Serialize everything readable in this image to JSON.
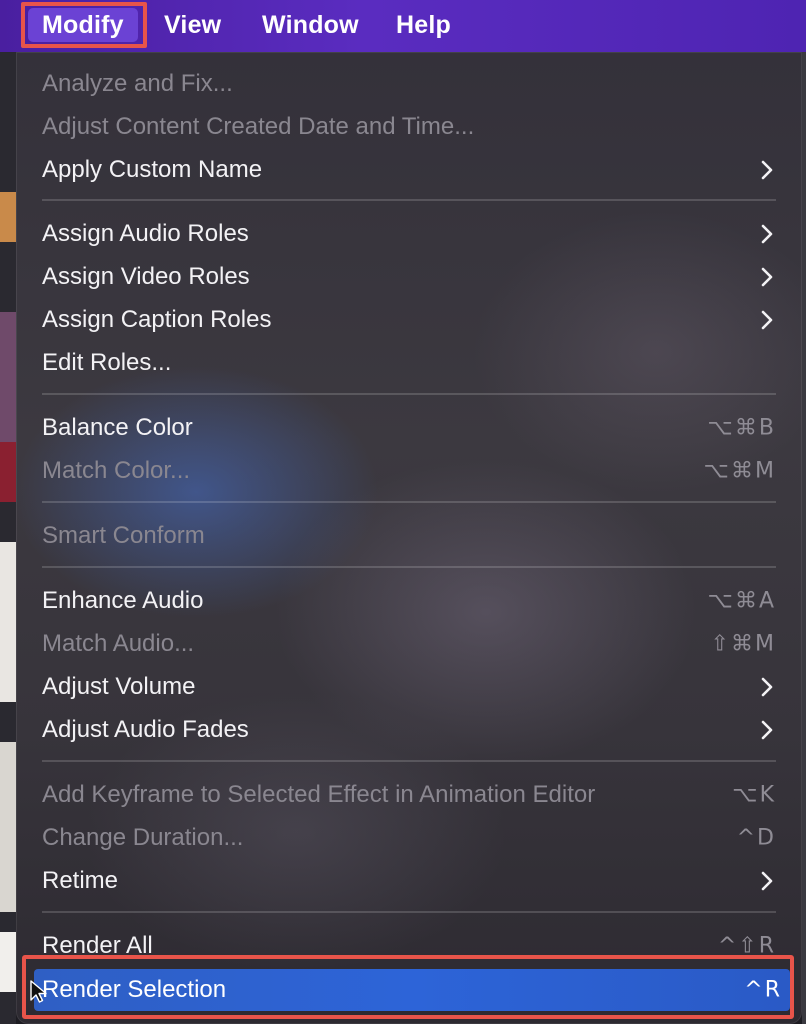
{
  "menubar": {
    "items": [
      {
        "label": "Modify",
        "active": true
      },
      {
        "label": "View",
        "active": false
      },
      {
        "label": "Window",
        "active": false
      },
      {
        "label": "Help",
        "active": false
      }
    ]
  },
  "menu": {
    "items": [
      {
        "label": "Analyze and Fix...",
        "enabled": false,
        "shortcut": "",
        "submenu": false
      },
      {
        "label": "Adjust Content Created Date and Time...",
        "enabled": false,
        "shortcut": "",
        "submenu": false
      },
      {
        "label": "Apply Custom Name",
        "enabled": true,
        "shortcut": "",
        "submenu": true
      },
      {
        "label": "Assign Audio Roles",
        "enabled": true,
        "shortcut": "",
        "submenu": true
      },
      {
        "label": "Assign Video Roles",
        "enabled": true,
        "shortcut": "",
        "submenu": true
      },
      {
        "label": "Assign Caption Roles",
        "enabled": true,
        "shortcut": "",
        "submenu": true
      },
      {
        "label": "Edit Roles...",
        "enabled": true,
        "shortcut": "",
        "submenu": false
      },
      {
        "label": "Balance Color",
        "enabled": true,
        "shortcut": "⌥⌘B",
        "submenu": false
      },
      {
        "label": "Match Color...",
        "enabled": false,
        "shortcut": "⌥⌘M",
        "submenu": false
      },
      {
        "label": "Smart Conform",
        "enabled": false,
        "shortcut": "",
        "submenu": false
      },
      {
        "label": "Enhance Audio",
        "enabled": true,
        "shortcut": "⌥⌘A",
        "submenu": false
      },
      {
        "label": "Match Audio...",
        "enabled": false,
        "shortcut": "⇧⌘M",
        "submenu": false
      },
      {
        "label": "Adjust Volume",
        "enabled": true,
        "shortcut": "",
        "submenu": true
      },
      {
        "label": "Adjust Audio Fades",
        "enabled": true,
        "shortcut": "",
        "submenu": true
      },
      {
        "label": "Add Keyframe to Selected Effect in Animation Editor",
        "enabled": false,
        "shortcut": "⌥K",
        "submenu": false
      },
      {
        "label": "Change Duration...",
        "enabled": false,
        "shortcut": "^D",
        "submenu": false
      },
      {
        "label": "Retime",
        "enabled": true,
        "shortcut": "",
        "submenu": true
      },
      {
        "label": "Render All",
        "enabled": true,
        "shortcut": "^⇧R",
        "submenu": false
      },
      {
        "label": "Render Selection",
        "enabled": true,
        "shortcut": "^R",
        "submenu": false,
        "selected": true
      }
    ]
  },
  "colors": {
    "menubar_bg": "#5a2cc0",
    "selection_blue": "#2d64d8",
    "annotation_red": "#e8544a",
    "disabled_text": "#8a8790"
  },
  "icons": {
    "submenu": "chevron-right-icon",
    "pointer": "mouse-pointer-icon"
  }
}
